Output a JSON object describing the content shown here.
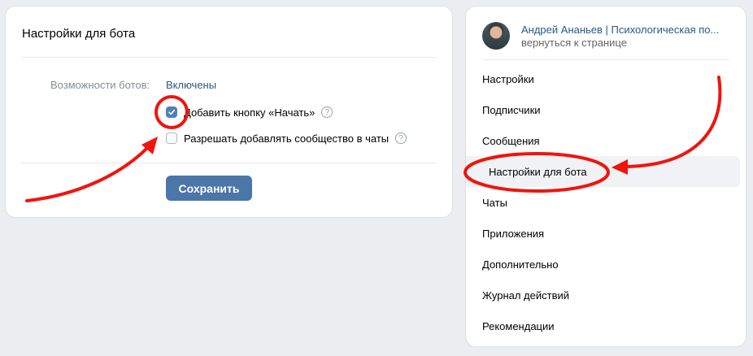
{
  "main": {
    "title": "Настройки для бота",
    "field_label": "Возможности ботов:",
    "field_value": "Включены",
    "checkboxes": [
      {
        "label": "Добавить кнопку «Начать»",
        "checked": true
      },
      {
        "label": "Разрешать добавлять сообщество в чаты",
        "checked": false
      }
    ],
    "save_label": "Сохранить"
  },
  "sidebar": {
    "profile_name": "Андрей Ананьев | Психологическая по...",
    "back_link": "вернуться к странице",
    "items": [
      {
        "label": "Настройки"
      },
      {
        "label": "Подписчики"
      },
      {
        "label": "Сообщения"
      },
      {
        "label": "Настройки для бота",
        "active": true
      },
      {
        "label": "Чаты"
      },
      {
        "label": "Приложения"
      },
      {
        "label": "Дополнительно"
      },
      {
        "label": "Журнал действий"
      },
      {
        "label": "Рекомендации"
      }
    ]
  },
  "annotations": {
    "color": "#f0140f"
  },
  "icons": {
    "help": "question-circle-icon",
    "check": "checkmark-icon"
  },
  "help_glyph": "?"
}
